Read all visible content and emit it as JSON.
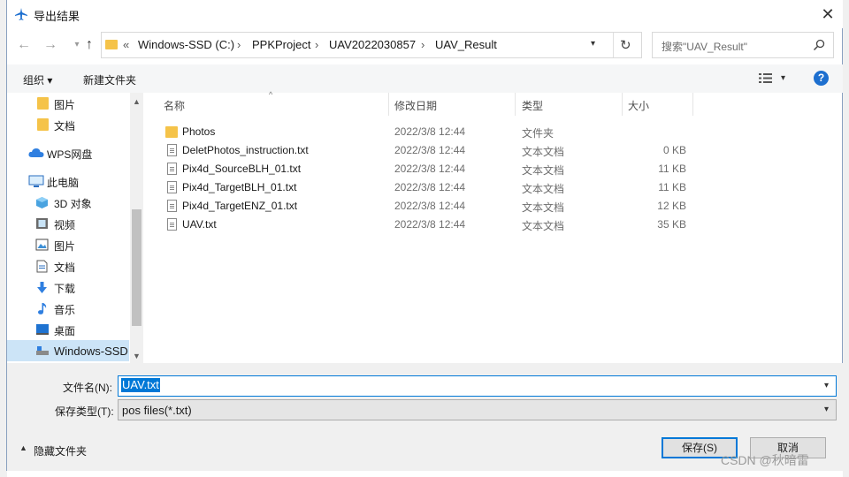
{
  "window": {
    "title": "导出结果",
    "close": "✕"
  },
  "nav": {
    "back": "←",
    "forward": "→",
    "up": "↑"
  },
  "address": {
    "overflow": "«",
    "crumbs": [
      "Windows-SSD (C:)",
      "PPKProject",
      "UAV2022030857",
      "UAV_Result"
    ],
    "separator": "›",
    "refresh": "↻"
  },
  "search": {
    "placeholder": "搜索\"UAV_Result\""
  },
  "toolbar": {
    "organize": "组织 ▾",
    "new_folder": "新建文件夹",
    "help": "?"
  },
  "sidebar": {
    "items": [
      {
        "label": "图片",
        "icon": "folder-icon"
      },
      {
        "label": "文档",
        "icon": "folder-icon"
      },
      {
        "label": "WPS网盘",
        "icon": "cloud-icon"
      },
      {
        "label": "此电脑",
        "icon": "computer-icon"
      },
      {
        "label": "3D 对象",
        "icon": "cube-icon"
      },
      {
        "label": "视频",
        "icon": "video-icon"
      },
      {
        "label": "图片",
        "icon": "picture-icon"
      },
      {
        "label": "文档",
        "icon": "document-icon"
      },
      {
        "label": "下载",
        "icon": "download-icon"
      },
      {
        "label": "音乐",
        "icon": "music-icon"
      },
      {
        "label": "桌面",
        "icon": "desktop-icon"
      },
      {
        "label": "Windows-SSD",
        "icon": "drive-icon"
      }
    ],
    "scroll_up": "▲",
    "scroll_down": "▼"
  },
  "columns": {
    "name": "名称",
    "date": "修改日期",
    "type": "类型",
    "size": "大小"
  },
  "files": [
    {
      "name": "Photos",
      "date": "2022/3/8 12:44",
      "type": "文件夹",
      "size": ""
    },
    {
      "name": "DeletPhotos_instruction.txt",
      "date": "2022/3/8 12:44",
      "type": "文本文档",
      "size": "0 KB"
    },
    {
      "name": "Pix4d_SourceBLH_01.txt",
      "date": "2022/3/8 12:44",
      "type": "文本文档",
      "size": "11 KB"
    },
    {
      "name": "Pix4d_TargetBLH_01.txt",
      "date": "2022/3/8 12:44",
      "type": "文本文档",
      "size": "11 KB"
    },
    {
      "name": "Pix4d_TargetENZ_01.txt",
      "date": "2022/3/8 12:44",
      "type": "文本文档",
      "size": "12 KB"
    },
    {
      "name": "UAV.txt",
      "date": "2022/3/8 12:44",
      "type": "文本文档",
      "size": "35 KB"
    }
  ],
  "form": {
    "filename_label": "文件名(N):",
    "filename_value": "UAV.txt",
    "filetype_label": "保存类型(T):",
    "filetype_value": "pos files(*.txt)"
  },
  "footer": {
    "hide_folders": "隐藏文件夹",
    "save": "保存(S)",
    "cancel": "取消"
  },
  "watermark": "CSDN @秋暗雷",
  "colors": {
    "accent": "#0078d7",
    "folder": "#f5c349",
    "selection": "#cce4f7"
  }
}
